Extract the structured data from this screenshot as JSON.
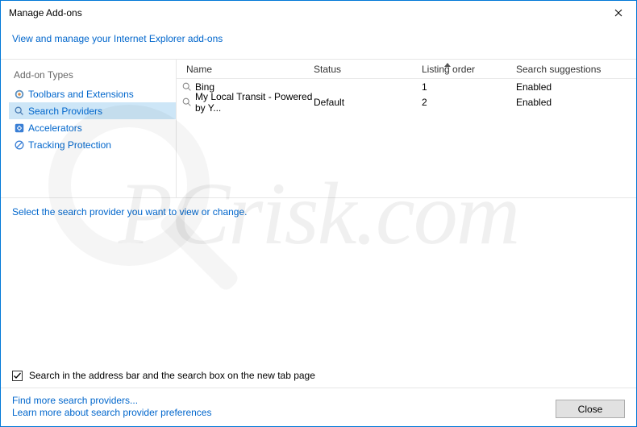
{
  "window": {
    "title": "Manage Add-ons"
  },
  "header": {
    "link": "View and manage your Internet Explorer add-ons"
  },
  "sidebar": {
    "heading": "Add-on Types",
    "items": [
      {
        "label": "Toolbars and Extensions"
      },
      {
        "label": "Search Providers"
      },
      {
        "label": "Accelerators"
      },
      {
        "label": "Tracking Protection"
      }
    ]
  },
  "table": {
    "headers": {
      "name": "Name",
      "status": "Status",
      "order": "Listing order",
      "sugg": "Search suggestions"
    },
    "rows": [
      {
        "name": "Bing",
        "status": "",
        "order": "1",
        "sugg": "Enabled"
      },
      {
        "name": "My Local Transit - Powered by Y...",
        "status": "Default",
        "order": "2",
        "sugg": "Enabled"
      }
    ]
  },
  "instruction": "Select the search provider you want to view or change.",
  "checkbox": {
    "label": "Search in the address bar and the search box on the new tab page",
    "checked": true
  },
  "bottom": {
    "link1": "Find more search providers...",
    "link2": "Learn more about search provider preferences",
    "close": "Close"
  }
}
